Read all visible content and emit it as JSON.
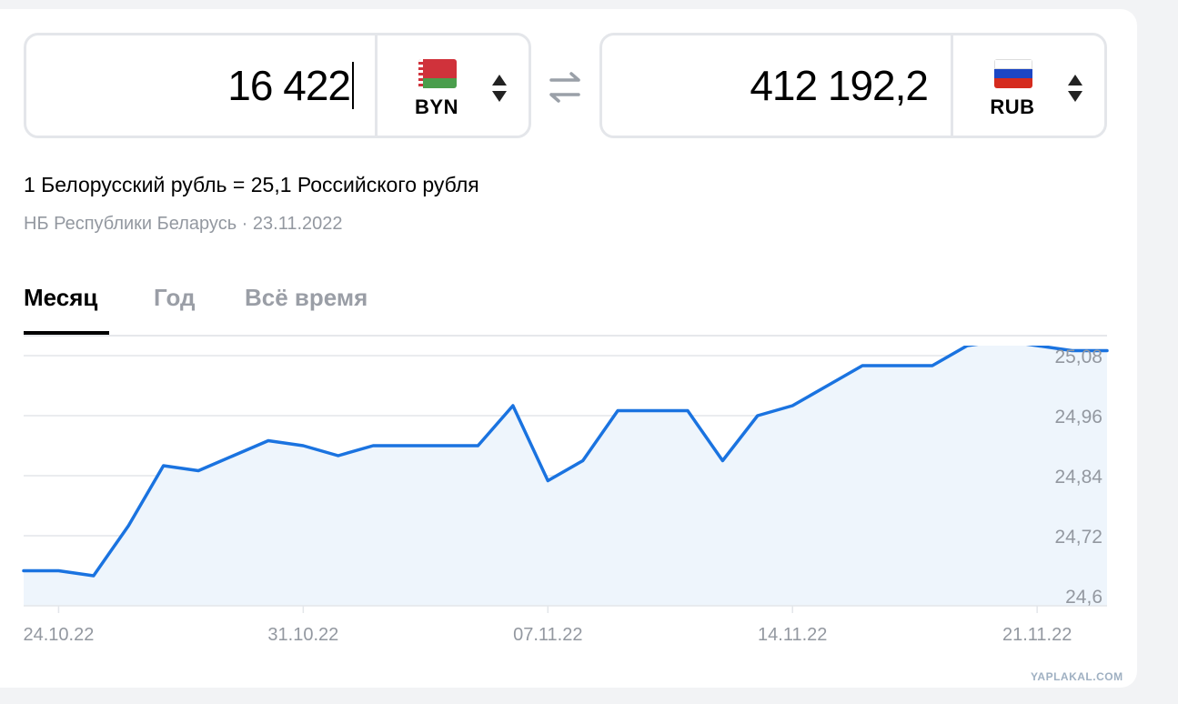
{
  "converter": {
    "from": {
      "amount": "16 422",
      "currency": "BYN"
    },
    "to": {
      "amount": "412 192,2",
      "currency": "RUB"
    }
  },
  "rate_text": "1 Белорусский рубль = 25,1 Российского рубля",
  "source_text": "НБ Республики Беларусь · 23.11.2022",
  "tabs": [
    {
      "label": "Месяц",
      "active": true
    },
    {
      "label": "Год",
      "active": false
    },
    {
      "label": "Всё время",
      "active": false
    }
  ],
  "colors": {
    "line": "#1a73e0",
    "fill": "#eef5fc",
    "grid": "#e3e6ea",
    "muted": "#9398a0"
  },
  "chart_data": {
    "type": "area",
    "title": "",
    "xlabel": "",
    "ylabel": "",
    "ylim": [
      24.58,
      25.1
    ],
    "yticks": [
      "24,6",
      "24,72",
      "24,84",
      "24,96",
      "25,08"
    ],
    "xticks": [
      "24.10.22",
      "31.10.22",
      "07.11.22",
      "14.11.22",
      "21.11.22"
    ],
    "grid": true,
    "series": [
      {
        "x": [
          "22.10.22",
          "24.10.22",
          "25.10.22",
          "26.10.22",
          "27.10.22",
          "28.10.22",
          "29.10.22",
          "30.10.22",
          "31.10.22",
          "01.11.22",
          "02.11.22",
          "03.11.22",
          "04.11.22",
          "05.11.22",
          "06.11.22",
          "07.11.22",
          "08.11.22",
          "09.11.22",
          "10.11.22",
          "11.11.22",
          "12.11.22",
          "13.11.22",
          "14.11.22",
          "15.11.22",
          "16.11.22",
          "17.11.22",
          "18.11.22",
          "19.11.22",
          "20.11.22",
          "21.11.22",
          "22.11.22",
          "23.11.22"
        ],
        "values": [
          24.65,
          24.65,
          24.64,
          24.74,
          24.86,
          24.85,
          24.88,
          24.91,
          24.9,
          24.88,
          24.9,
          24.9,
          24.9,
          24.9,
          24.98,
          24.83,
          24.87,
          24.97,
          24.97,
          24.97,
          24.87,
          24.96,
          24.98,
          25.02,
          25.06,
          25.06,
          25.06,
          25.1,
          25.11,
          25.1,
          25.09,
          25.09
        ]
      }
    ]
  },
  "watermark": "YAPLAKAL.COM"
}
